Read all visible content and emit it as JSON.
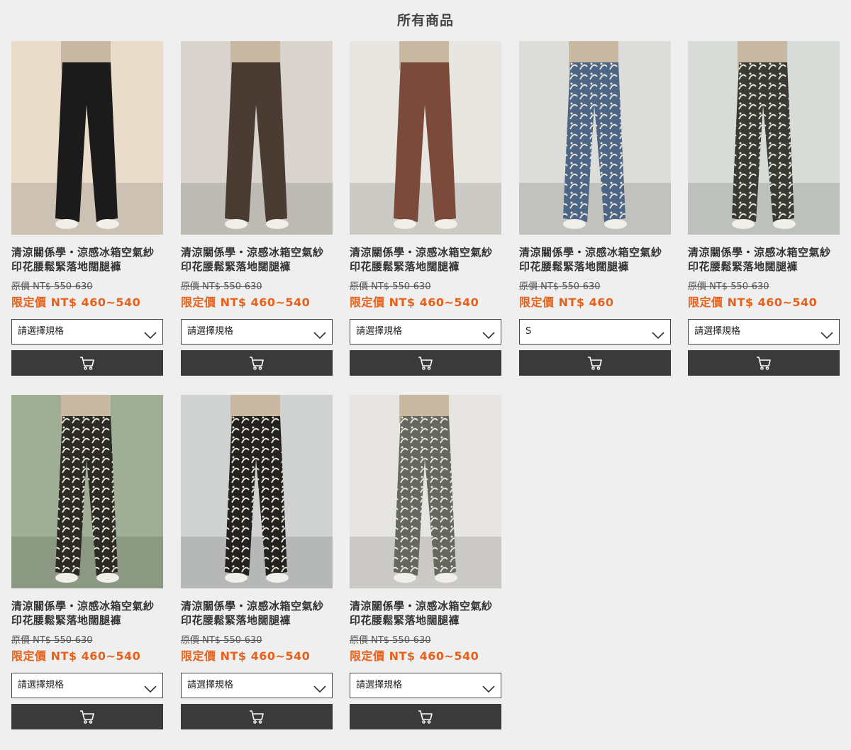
{
  "page": {
    "title": "所有商品"
  },
  "products": [
    {
      "name": "清涼關係學・涼感冰箱空氣紗印花腰鬆緊落地闊腿褲",
      "original_price": "原價 NT$ 550-630",
      "sale_price": "限定價 NT$ 460~540",
      "spec": "請選擇規格",
      "image": "black-solid-pants",
      "colors": {
        "bg": "#e9dccb",
        "pant": "#1b1b1b"
      }
    },
    {
      "name": "清涼關係學・涼感冰箱空氣紗印花腰鬆緊落地闊腿褲",
      "original_price": "原價 NT$ 550-630",
      "sale_price": "限定價 NT$ 460~540",
      "spec": "請選擇規格",
      "image": "brown-solid-pants",
      "colors": {
        "bg": "#d9d4cd",
        "pant": "#4a3b33"
      }
    },
    {
      "name": "清涼關係學・涼感冰箱空氣紗印花腰鬆緊落地闊腿褲",
      "original_price": "原價 NT$ 550-630",
      "sale_price": "限定價 NT$ 460~540",
      "spec": "請選擇規格",
      "image": "rust-solid-pants",
      "colors": {
        "bg": "#e8e6e1",
        "pant": "#7c4a3b"
      }
    },
    {
      "name": "清涼關係學・涼感冰箱空氣紗印花腰鬆緊落地闊腿褲",
      "original_price": "原價 NT$ 550-630",
      "sale_price": "限定價 NT$ 460",
      "spec": "S",
      "image": "blue-floral-pants",
      "colors": {
        "bg": "#dcdcd8",
        "pant": "#4d6585"
      }
    },
    {
      "name": "清涼關係學・涼感冰箱空氣紗印花腰鬆緊落地闊腿褲",
      "original_price": "原價 NT$ 550-630",
      "sale_price": "限定價 NT$ 460~540",
      "spec": "請選擇規格",
      "image": "patchwork-print-pants",
      "colors": {
        "bg": "#d8dcd8",
        "pant": "#3a3a34"
      }
    },
    {
      "name": "清涼關係學・涼感冰箱空氣紗印花腰鬆緊落地闊腿褲",
      "original_price": "原價 NT$ 550-630",
      "sale_price": "限定價 NT$ 460~540",
      "spec": "請選擇規格",
      "image": "black-leaf-print-pants",
      "colors": {
        "bg": "#9fae95",
        "pant": "#2c2a24"
      }
    },
    {
      "name": "清涼關係學・涼感冰箱空氣紗印花腰鬆緊落地闊腿褲",
      "original_price": "原價 NT$ 550-630",
      "sale_price": "限定價 NT$ 460~540",
      "spec": "請選擇規格",
      "image": "black-abstract-print-pants",
      "colors": {
        "bg": "#cfd2d0",
        "pant": "#23221f"
      }
    },
    {
      "name": "清涼關係學・涼感冰箱空氣紗印花腰鬆緊落地闊腿褲",
      "original_price": "原價 NT$ 550-630",
      "sale_price": "限定價 NT$ 460~540",
      "spec": "請選擇規格",
      "image": "grey-leaf-print-pants",
      "colors": {
        "bg": "#e6e5e2",
        "pant": "#66675e"
      }
    }
  ],
  "icons": {
    "dropdown": "chevron-down-icon",
    "cart": "shopping-cart-icon"
  },
  "colors": {
    "accent": "#e7611a",
    "button": "#3a3a3a",
    "background": "#efefef"
  }
}
